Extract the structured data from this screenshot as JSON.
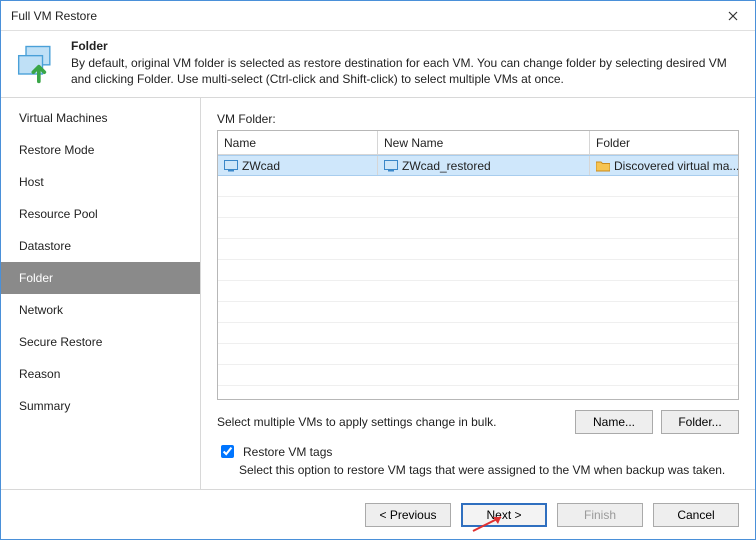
{
  "window": {
    "title": "Full VM Restore"
  },
  "header": {
    "title": "Folder",
    "description": "By default, original VM folder is selected as restore destination for each VM. You can change folder by selecting desired VM and clicking Folder. Use multi-select (Ctrl-click and Shift-click) to select multiple VMs at once."
  },
  "sidebar": {
    "items": [
      {
        "label": "Virtual Machines",
        "active": false
      },
      {
        "label": "Restore Mode",
        "active": false
      },
      {
        "label": "Host",
        "active": false
      },
      {
        "label": "Resource Pool",
        "active": false
      },
      {
        "label": "Datastore",
        "active": false
      },
      {
        "label": "Folder",
        "active": true
      },
      {
        "label": "Network",
        "active": false
      },
      {
        "label": "Secure Restore",
        "active": false
      },
      {
        "label": "Reason",
        "active": false
      },
      {
        "label": "Summary",
        "active": false
      }
    ]
  },
  "main": {
    "grid_label": "VM Folder:",
    "columns": {
      "name": "Name",
      "new_name": "New Name",
      "folder": "Folder"
    },
    "rows": [
      {
        "name": "ZWcad",
        "new_name": "ZWcad_restored",
        "folder": "Discovered virtual ma..."
      }
    ],
    "bulk_hint": "Select multiple VMs to apply settings change in bulk.",
    "name_button": "Name...",
    "folder_button": "Folder...",
    "restore_tags": {
      "checked": true,
      "label": "Restore VM tags",
      "description": "Select this option to restore VM tags that were assigned to the VM when backup was taken."
    }
  },
  "footer": {
    "previous": "< Previous",
    "next": "Next >",
    "finish": "Finish",
    "cancel": "Cancel"
  }
}
